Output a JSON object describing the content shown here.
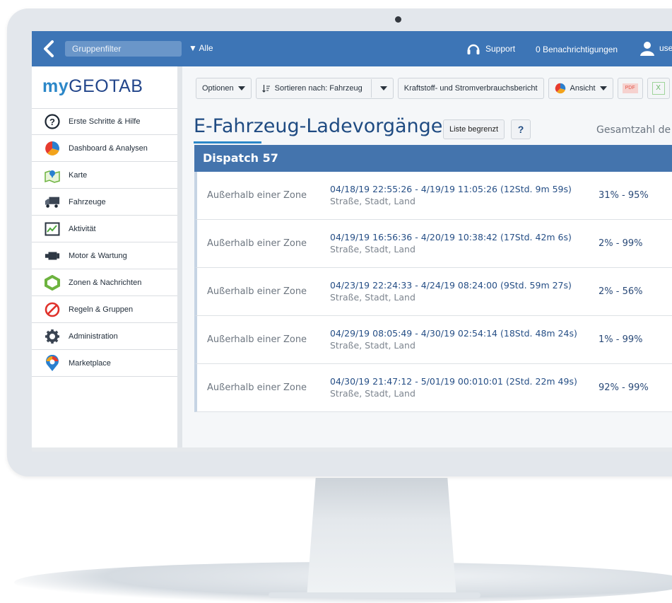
{
  "topbar": {
    "group_filter_placeholder": "Gruppenfilter",
    "group_selected": "▼ Alle",
    "support_label": "Support",
    "notifications_label": "0 Benachrichtigungen",
    "user_label": "use"
  },
  "sidebar": {
    "logo_my": "my",
    "logo_geotab": "GEOTAB",
    "items": [
      {
        "label": "Erste Schritte & Hilfe",
        "icon": "help-circle-icon"
      },
      {
        "label": "Dashboard & Analysen",
        "icon": "pie-chart-icon"
      },
      {
        "label": "Karte",
        "icon": "map-icon"
      },
      {
        "label": "Fahrzeuge",
        "icon": "truck-icon"
      },
      {
        "label": "Aktivität",
        "icon": "activity-chart-icon"
      },
      {
        "label": "Motor & Wartung",
        "icon": "engine-icon"
      },
      {
        "label": "Zonen & Nachrichten",
        "icon": "zone-icon"
      },
      {
        "label": "Regeln & Gruppen",
        "icon": "prohibited-icon"
      },
      {
        "label": "Administration",
        "icon": "gear-icon"
      },
      {
        "label": "Marketplace",
        "icon": "marketplace-pin-icon"
      }
    ]
  },
  "toolbar": {
    "options_label": "Optionen",
    "sort_label": "Sortieren nach: Fahrzeug",
    "report_label": "Kraftstoff- und Stromverbrauchsbericht",
    "view_label": "Ansicht",
    "pdf_label": "PDF",
    "excel_label": "X"
  },
  "page": {
    "title": "E-Fahrzeug-Ladevorgänge",
    "limited_label": "Liste begrenzt",
    "help_label": "?",
    "total_label": "Gesamtzahl de"
  },
  "group": {
    "name": "Dispatch 57"
  },
  "rows": [
    {
      "zone": "Außerhalb einer Zone",
      "time": "04/18/19 22:55:26 - 4/19/19 11:05:26 (12Std. 9m 59s)",
      "address": "Straße, Stadt, Land",
      "range": "31% - 95%"
    },
    {
      "zone": "Außerhalb einer Zone",
      "time": "04/19/19 16:56:36 - 4/20/19 10:38:42 (17Std. 42m 6s)",
      "address": "Straße, Stadt, Land",
      "range": "2% - 99%"
    },
    {
      "zone": "Außerhalb einer Zone",
      "time": "04/23/19 22:24:33 - 4/24/19 08:24:00 (9Std. 59m 27s)",
      "address": "Straße, Stadt, Land",
      "range": "2% - 56%"
    },
    {
      "zone": "Außerhalb einer Zone",
      "time": "04/29/19 08:05:49 - 4/30/19 02:54:14 (18Std. 48m 24s)",
      "address": "Straße, Stadt, Land",
      "range": "1% - 99%"
    },
    {
      "zone": "Außerhalb einer Zone",
      "time": "04/30/19 21:47:12 - 5/01/19 00:010:01 (2Std. 22m 49s)",
      "address": "Straße, Stadt, Land",
      "range": "92% - 99%"
    }
  ],
  "colors": {
    "topbar": "#3d75b6",
    "group_header": "#4474ad",
    "title": "#1f4b82",
    "accent": "#2b87c8"
  }
}
